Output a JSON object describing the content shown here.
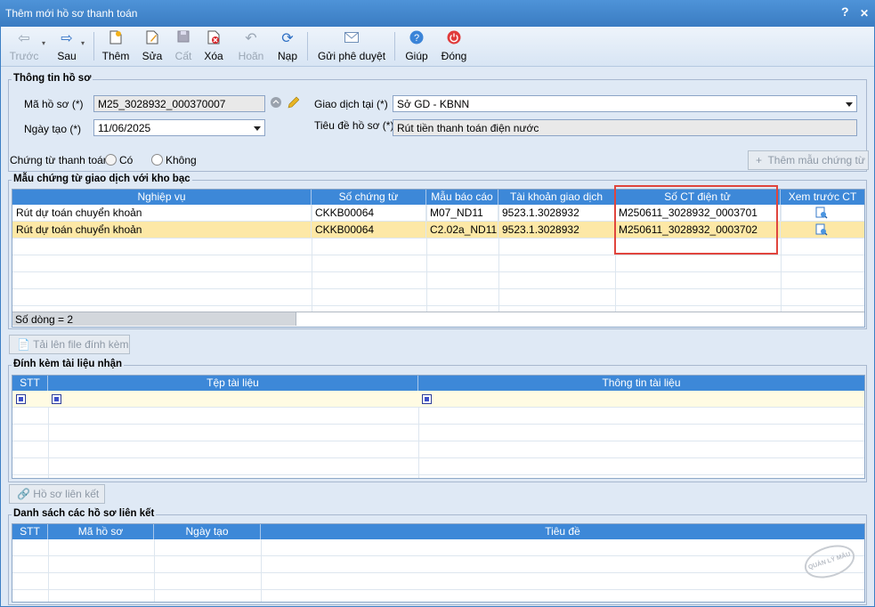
{
  "window": {
    "title": "Thêm mới hồ sơ thanh toán",
    "help": "?",
    "close": "✕"
  },
  "toolbar": {
    "back": "Trước",
    "next": "Sau",
    "add": "Thêm",
    "edit": "Sửa",
    "save": "Cất",
    "delete": "Xóa",
    "undo": "Hoãn",
    "reload": "Nạp",
    "send": "Gửi phê duyệt",
    "help": "Giúp",
    "close": "Đóng"
  },
  "info": {
    "title": "Thông tin hồ sơ",
    "code_label": "Mã hồ sơ (*)",
    "code_value": "M25_3028932_000370007",
    "date_label": "Ngày tạo (*)",
    "date_value": "11/06/2025",
    "place_label": "Giao dịch tại (*)",
    "place_value": "Sở GD - KBNN",
    "subject_label": "Tiêu đề hồ sơ (*)",
    "subject_value": "Rút tiền thanh toán điện nước"
  },
  "voucher": {
    "label": "Chứng từ thanh toán:",
    "yes": "Có",
    "no": "Không",
    "add_template": "Thêm mẫu chứng từ"
  },
  "templates": {
    "title": "Mẫu chứng từ giao dịch với kho bạc",
    "columns": [
      "Nghiệp vụ",
      "Số chứng từ",
      "Mẫu báo cáo",
      "Tài khoản giao dịch",
      "Số CT điện tử",
      "Xem trước CT"
    ],
    "rows": [
      {
        "op": "Rút dự toán chuyển khoản",
        "no": "CKKB00064",
        "form": "M07_ND11",
        "acc": "9523.1.3028932",
        "eno": "M250611_3028932_0003701"
      },
      {
        "op": "Rút dự toán chuyển khoản",
        "no": "CKKB00064",
        "form": "C2.02a_ND11",
        "acc": "9523.1.3028932",
        "eno": "M250611_3028932_0003702"
      }
    ],
    "footer": "Số dòng = 2",
    "highlight_color": "#e0453d",
    "selected_row_color": "#fde8a6"
  },
  "upload_button": "Tải lên file đính kèm",
  "attachments": {
    "title": "Đính kèm tài liệu nhận",
    "columns": [
      "STT",
      "Tệp tài liệu",
      "Thông tin tài liệu"
    ]
  },
  "link_button": "Hồ sơ liên kết",
  "linked": {
    "title": "Danh sách các hồ sơ liên kết",
    "columns": [
      "STT",
      "Mã hồ sơ",
      "Ngày tạo",
      "Tiêu đề"
    ]
  },
  "watermark": "QUẢN LÝ MẪU"
}
